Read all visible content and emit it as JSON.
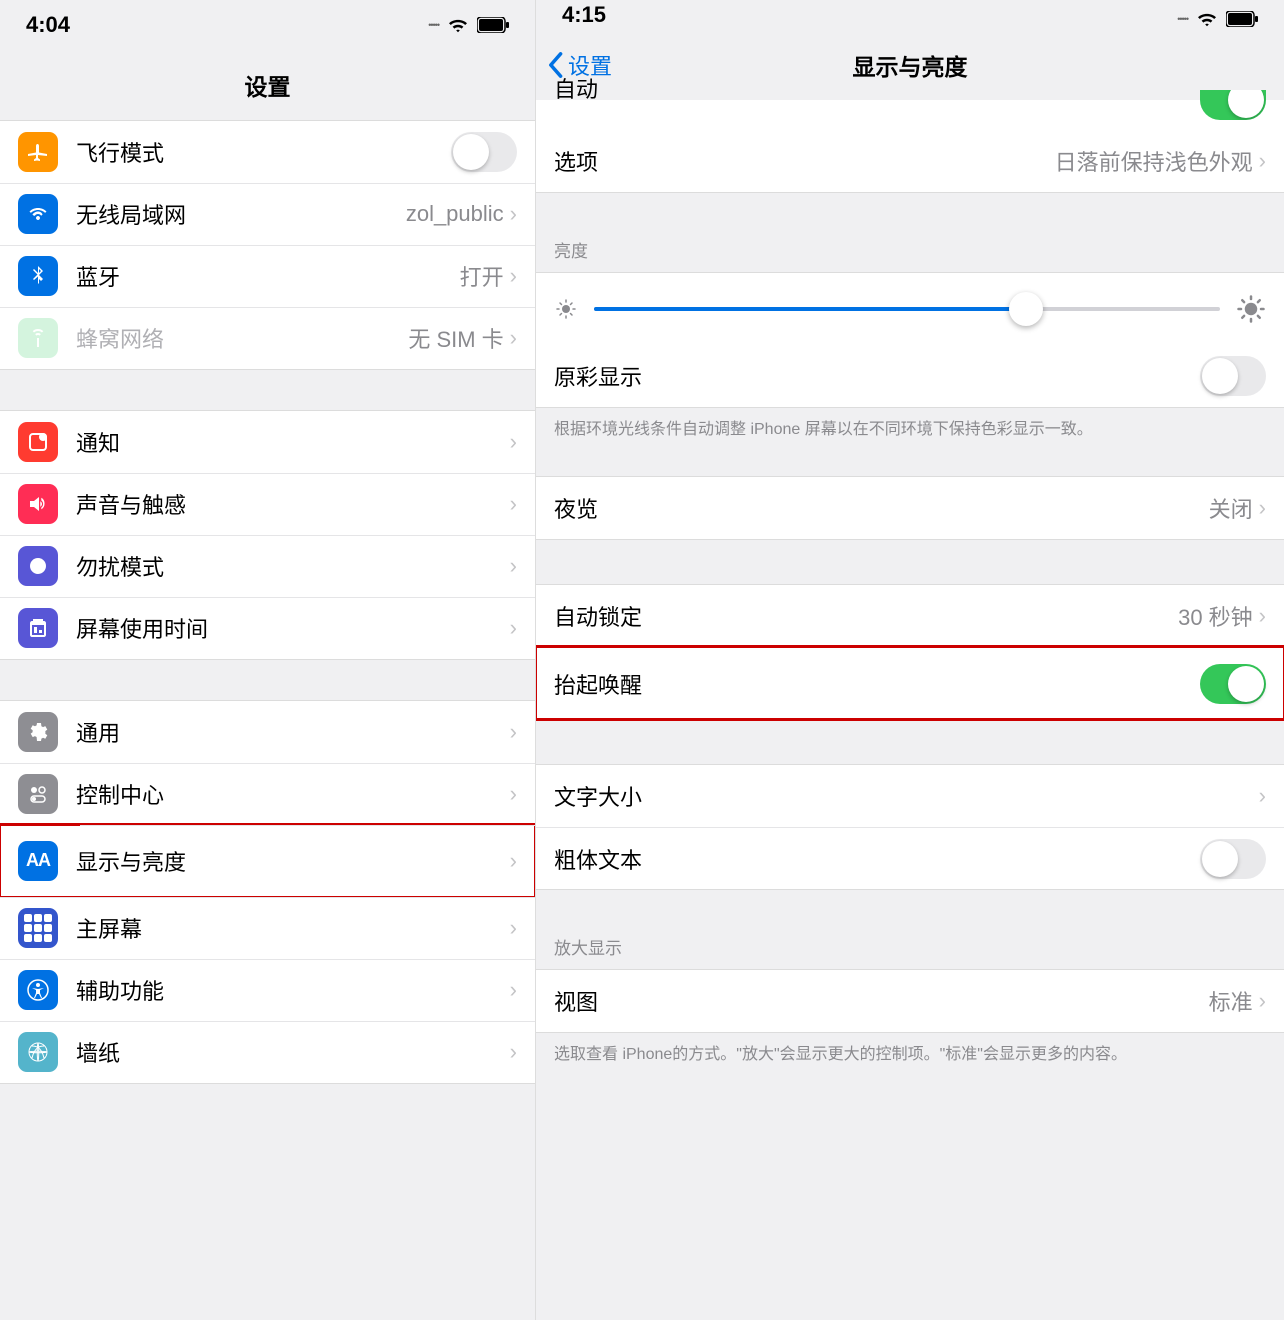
{
  "left": {
    "status": {
      "time": "4:04"
    },
    "nav": {
      "title": "设置"
    },
    "group1": [
      {
        "icon": "airplane",
        "color": "#ff9500",
        "label": "飞行模式",
        "type": "toggle",
        "on": false
      },
      {
        "icon": "wifi",
        "color": "#0071e3",
        "label": "无线局域网",
        "value": "zol_public",
        "type": "link"
      },
      {
        "icon": "bluetooth",
        "color": "#0071e3",
        "label": "蓝牙",
        "value": "打开",
        "type": "link"
      },
      {
        "icon": "cellular",
        "color": "#b8eec9",
        "label": "蜂窝网络",
        "value": "无 SIM 卡",
        "type": "link",
        "dim": true
      }
    ],
    "group2": [
      {
        "icon": "notification",
        "color": "#ff3b30",
        "label": "通知",
        "type": "link"
      },
      {
        "icon": "sound",
        "color": "#ff2d55",
        "label": "声音与触感",
        "type": "link"
      },
      {
        "icon": "dnd",
        "color": "#5856d6",
        "label": "勿扰模式",
        "type": "link"
      },
      {
        "icon": "screentime",
        "color": "#5856d6",
        "label": "屏幕使用时间",
        "type": "link"
      }
    ],
    "group3": [
      {
        "icon": "general",
        "color": "#8e8e93",
        "label": "通用",
        "type": "link"
      },
      {
        "icon": "control",
        "color": "#8e8e93",
        "label": "控制中心",
        "type": "link"
      },
      {
        "icon": "display",
        "color": "#0071e3",
        "label": "显示与亮度",
        "type": "link",
        "highlight": true
      },
      {
        "icon": "home",
        "color": "#3355cc",
        "label": "主屏幕",
        "type": "link"
      },
      {
        "icon": "accessibility",
        "color": "#0071e3",
        "label": "辅助功能",
        "type": "link"
      },
      {
        "icon": "wallpaper",
        "color": "#54b4cb",
        "label": "墙纸",
        "type": "link"
      }
    ]
  },
  "right": {
    "status": {
      "time": "4:15"
    },
    "nav": {
      "back": "设置",
      "title": "显示与亮度"
    },
    "auto_partial_label": "自动",
    "options": {
      "label": "选项",
      "value": "日落前保持浅色外观"
    },
    "brightness_header": "亮度",
    "brightness_pct": 69,
    "true_tone": {
      "label": "原彩显示",
      "on": false
    },
    "true_tone_footer": "根据环境光线条件自动调整 iPhone 屏幕以在不同环境下保持色彩显示一致。",
    "night_shift": {
      "label": "夜览",
      "value": "关闭"
    },
    "auto_lock": {
      "label": "自动锁定",
      "value": "30 秒钟"
    },
    "raise_to_wake": {
      "label": "抬起唤醒",
      "on": true,
      "highlight": true
    },
    "text_size": {
      "label": "文字大小"
    },
    "bold_text": {
      "label": "粗体文本",
      "on": false
    },
    "zoom_header": "放大显示",
    "view": {
      "label": "视图",
      "value": "标准"
    },
    "zoom_footer": "选取查看 iPhone的方式。\"放大\"会显示更大的控制项。\"标准\"会显示更多的内容。"
  }
}
